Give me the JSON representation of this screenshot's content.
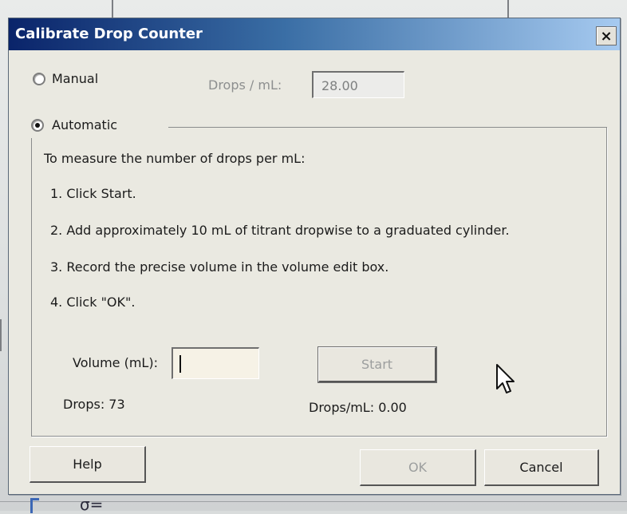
{
  "dialog": {
    "title": "Calibrate Drop Counter",
    "close_glyph": "×"
  },
  "manual": {
    "label": "Manual",
    "selected": false,
    "drops_per_ml_label": "Drops / mL:",
    "drops_per_ml_value": "28.00"
  },
  "automatic": {
    "label": "Automatic",
    "selected": true,
    "instructions_heading": "To measure the number of drops per mL:",
    "steps": [
      "1. Click Start.",
      "2. Add approximately 10 mL of titrant dropwise to a graduated cylinder.",
      "3. Record the precise volume in the volume edit box.",
      "4. Click \"OK\"."
    ],
    "volume_label": "Volume (mL):",
    "volume_value": "",
    "start_label": "Start",
    "drops_readout": "Drops: 73",
    "drops_per_ml_readout": "Drops/mL: 0.00"
  },
  "footer": {
    "help_label": "Help",
    "ok_label": "OK",
    "cancel_label": "Cancel"
  },
  "colors": {
    "titlebar_start": "#0a246a",
    "titlebar_end": "#a6caf0",
    "dialog_face": "#eae9e1",
    "disabled_text": "#9c9e9e"
  },
  "icons": {
    "close": "close-icon",
    "cursor": "mouse-pointer-icon"
  }
}
